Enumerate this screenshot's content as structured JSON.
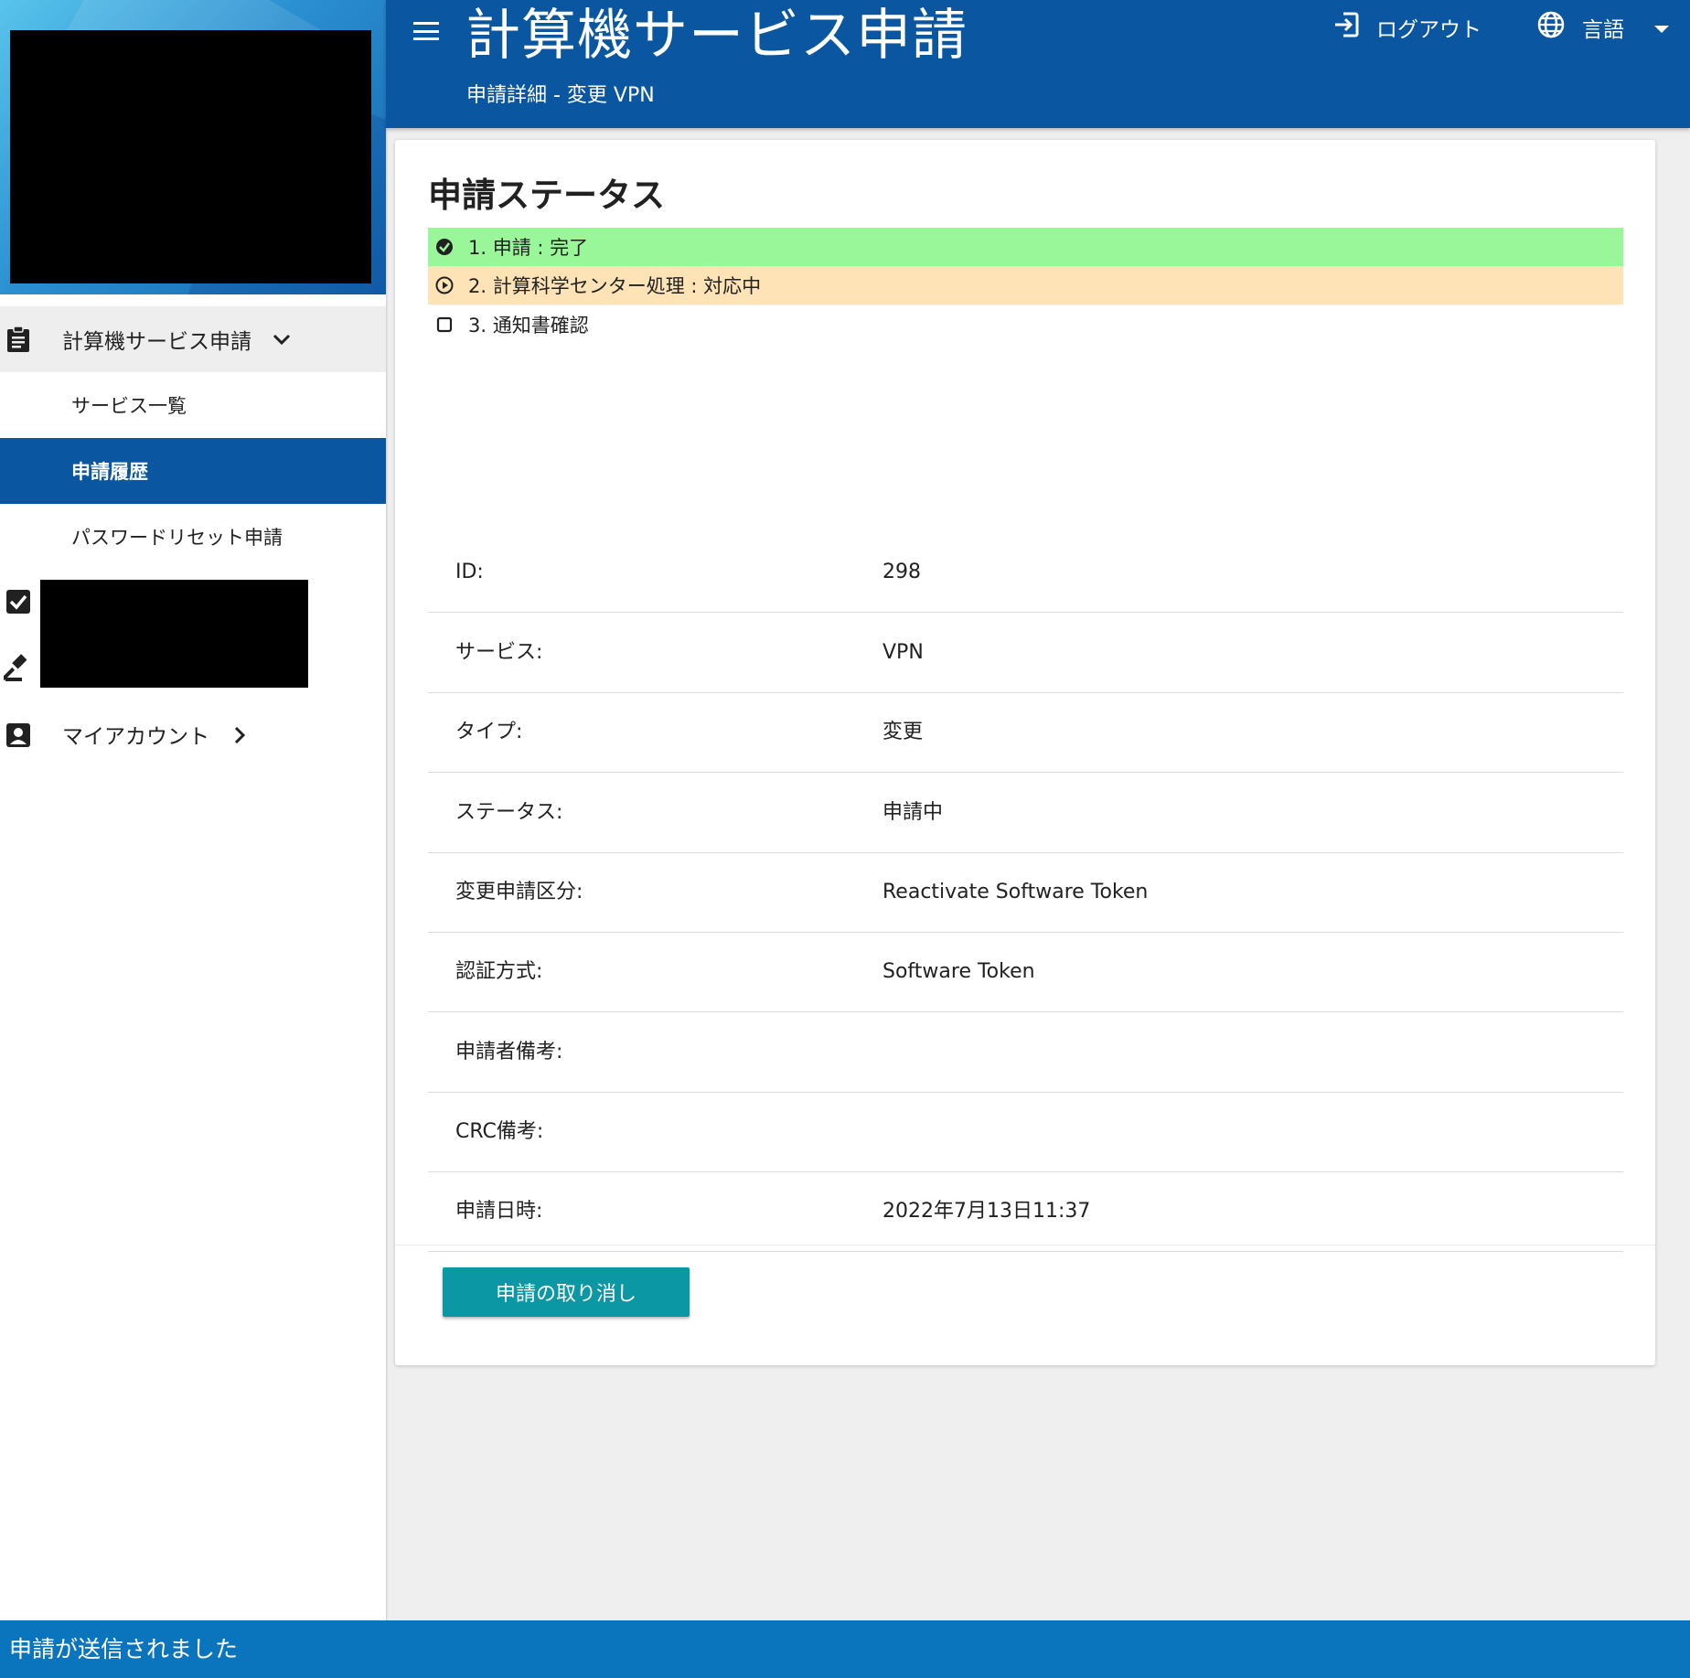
{
  "header": {
    "title": "計算機サービス申請",
    "subtitle": "申請詳細 - 変更 VPN",
    "logout_label": "ログアウト",
    "language_label": "言語"
  },
  "sidebar": {
    "group_label": "計算機サービス申請",
    "sub_items": [
      {
        "label": "サービス一覧",
        "active": false
      },
      {
        "label": "申請履歴",
        "active": true
      },
      {
        "label": "パスワードリセット申請",
        "active": false
      }
    ],
    "account_label": "マイアカウント"
  },
  "status": {
    "title": "申請ステータス",
    "steps": [
      {
        "label": "1. 申請 : 完了",
        "state": "done"
      },
      {
        "label": "2. 計算科学センター処理 : 対応中",
        "state": "in-progress"
      },
      {
        "label": "3. 通知書確認",
        "state": "pending"
      }
    ]
  },
  "details": [
    {
      "label": "ID:",
      "value": "298"
    },
    {
      "label": "サービス:",
      "value": "VPN"
    },
    {
      "label": "タイプ:",
      "value": "変更"
    },
    {
      "label": "ステータス:",
      "value": "申請中"
    },
    {
      "label": "変更申請区分:",
      "value": "Reactivate Software Token"
    },
    {
      "label": "認証方式:",
      "value": "Software Token"
    },
    {
      "label": "申請者備考:",
      "value": ""
    },
    {
      "label": "CRC備考:",
      "value": ""
    },
    {
      "label": "申請日時:",
      "value": "2022年7月13日11:37"
    }
  ],
  "actions": {
    "cancel_label": "申請の取り消し"
  },
  "snackbar": {
    "message": "申請が送信されました"
  },
  "colors": {
    "header_bg": "#0a56a0",
    "active_nav_bg": "#0a56a0",
    "step_done_bg": "#99f799",
    "step_progress_bg": "#fee3b6",
    "cancel_button_bg": "#0b98a4",
    "snackbar_bg": "#0a74bd"
  },
  "icons": {
    "menu": "hamburger-menu-icon",
    "logout": "logout-icon",
    "language": "globe-icon",
    "language_dropdown": "caret-down-icon",
    "service_group": "clipboard-icon",
    "group_expand": "chevron-down-icon",
    "check_item": "checkbox-checked-icon",
    "gavel_item": "gavel-icon",
    "account": "account-box-icon",
    "account_chevron": "chevron-right-icon",
    "step_done": "check-circle-icon",
    "step_progress": "play-circle-icon",
    "step_pending": "empty-square-icon"
  }
}
